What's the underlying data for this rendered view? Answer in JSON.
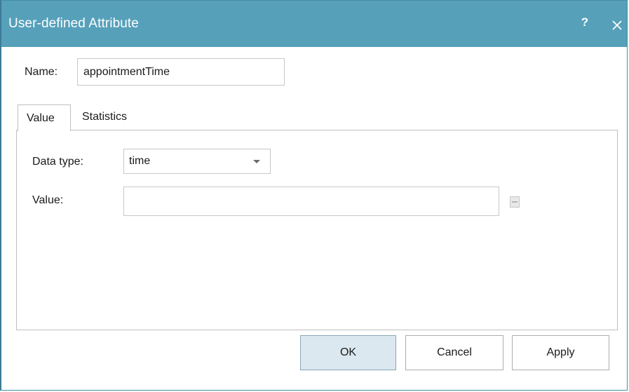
{
  "window": {
    "title": "User-defined Attribute",
    "help_label": "?",
    "close_icon": "close-icon",
    "title_bar_color": "#56a0ba"
  },
  "name_field": {
    "label": "Name:",
    "value": "appointmentTime"
  },
  "tabs": [
    {
      "label": "Value",
      "active": true
    },
    {
      "label": "Statistics",
      "active": false
    }
  ],
  "value_tab": {
    "data_type": {
      "label": "Data type:",
      "selected": "time"
    },
    "value": {
      "label": "Value:",
      "value": ""
    }
  },
  "buttons": {
    "ok": "OK",
    "cancel": "Cancel",
    "apply": "Apply"
  },
  "colors": {
    "default_button": "#dbe8ef"
  }
}
